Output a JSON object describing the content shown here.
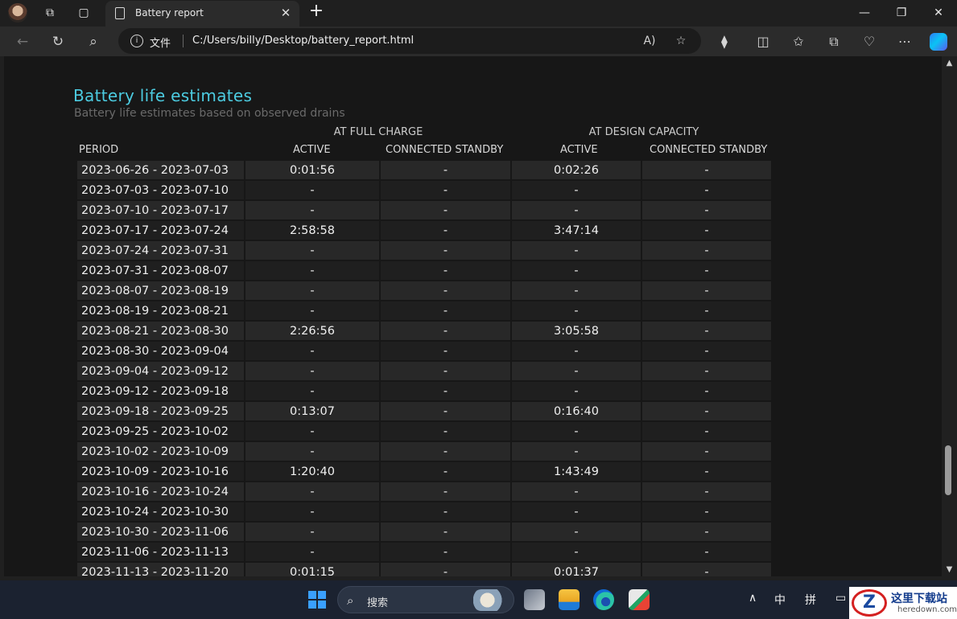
{
  "browser": {
    "tab_title": "Battery report",
    "address_label": "文件",
    "url": "C:/Users/billy/Desktop/battery_report.html"
  },
  "report": {
    "section_title": "Battery life estimates",
    "section_subtitle": "Battery life estimates based on observed drains",
    "group_full": "AT FULL CHARGE",
    "group_design": "AT DESIGN CAPACITY",
    "col_period": "PERIOD",
    "col_active_full": "ACTIVE",
    "col_standby_full": "CONNECTED STANDBY",
    "col_active_design": "ACTIVE",
    "col_standby_design": "CONNECTED STANDBY",
    "rows": [
      {
        "period": "2023-06-26 - 2023-07-03",
        "active_full": "0:01:56",
        "standby_full": "-",
        "active_design": "0:02:26",
        "standby_design": "-"
      },
      {
        "period": "2023-07-03 - 2023-07-10",
        "active_full": "-",
        "standby_full": "-",
        "active_design": "-",
        "standby_design": "-"
      },
      {
        "period": "2023-07-10 - 2023-07-17",
        "active_full": "-",
        "standby_full": "-",
        "active_design": "-",
        "standby_design": "-"
      },
      {
        "period": "2023-07-17 - 2023-07-24",
        "active_full": "2:58:58",
        "standby_full": "-",
        "active_design": "3:47:14",
        "standby_design": "-"
      },
      {
        "period": "2023-07-24 - 2023-07-31",
        "active_full": "-",
        "standby_full": "-",
        "active_design": "-",
        "standby_design": "-"
      },
      {
        "period": "2023-07-31 - 2023-08-07",
        "active_full": "-",
        "standby_full": "-",
        "active_design": "-",
        "standby_design": "-"
      },
      {
        "period": "2023-08-07 - 2023-08-19",
        "active_full": "-",
        "standby_full": "-",
        "active_design": "-",
        "standby_design": "-"
      },
      {
        "period": "2023-08-19 - 2023-08-21",
        "active_full": "-",
        "standby_full": "-",
        "active_design": "-",
        "standby_design": "-"
      },
      {
        "period": "2023-08-21 - 2023-08-30",
        "active_full": "2:26:56",
        "standby_full": "-",
        "active_design": "3:05:58",
        "standby_design": "-"
      },
      {
        "period": "2023-08-30 - 2023-09-04",
        "active_full": "-",
        "standby_full": "-",
        "active_design": "-",
        "standby_design": "-"
      },
      {
        "period": "2023-09-04 - 2023-09-12",
        "active_full": "-",
        "standby_full": "-",
        "active_design": "-",
        "standby_design": "-"
      },
      {
        "period": "2023-09-12 - 2023-09-18",
        "active_full": "-",
        "standby_full": "-",
        "active_design": "-",
        "standby_design": "-"
      },
      {
        "period": "2023-09-18 - 2023-09-25",
        "active_full": "0:13:07",
        "standby_full": "-",
        "active_design": "0:16:40",
        "standby_design": "-"
      },
      {
        "period": "2023-09-25 - 2023-10-02",
        "active_full": "-",
        "standby_full": "-",
        "active_design": "-",
        "standby_design": "-"
      },
      {
        "period": "2023-10-02 - 2023-10-09",
        "active_full": "-",
        "standby_full": "-",
        "active_design": "-",
        "standby_design": "-"
      },
      {
        "period": "2023-10-09 - 2023-10-16",
        "active_full": "1:20:40",
        "standby_full": "-",
        "active_design": "1:43:49",
        "standby_design": "-"
      },
      {
        "period": "2023-10-16 - 2023-10-24",
        "active_full": "-",
        "standby_full": "-",
        "active_design": "-",
        "standby_design": "-"
      },
      {
        "period": "2023-10-24 - 2023-10-30",
        "active_full": "-",
        "standby_full": "-",
        "active_design": "-",
        "standby_design": "-"
      },
      {
        "period": "2023-10-30 - 2023-11-06",
        "active_full": "-",
        "standby_full": "-",
        "active_design": "-",
        "standby_design": "-"
      },
      {
        "period": "2023-11-06 - 2023-11-13",
        "active_full": "-",
        "standby_full": "-",
        "active_design": "-",
        "standby_design": "-"
      },
      {
        "period": "2023-11-13 - 2023-11-20",
        "active_full": "0:01:15",
        "standby_full": "-",
        "active_design": "0:01:37",
        "standby_design": "-"
      }
    ]
  },
  "taskbar": {
    "search_label": "搜索",
    "ime_lang": "中",
    "ime_mode": "拼"
  },
  "watermark": {
    "title": "这里下载站",
    "sub": "heredown.com"
  },
  "icons": {
    "back": "arrow-left-icon",
    "refresh": "refresh-icon",
    "search": "search-icon",
    "info": "info-icon",
    "read_aloud": "read-aloud-icon",
    "favorite": "star-icon",
    "extensions": "puzzle-icon",
    "split": "split-screen-icon",
    "favorites": "favorites-icon",
    "collections": "collections-icon",
    "health": "heart-pulse-icon",
    "more": "more-icon"
  }
}
